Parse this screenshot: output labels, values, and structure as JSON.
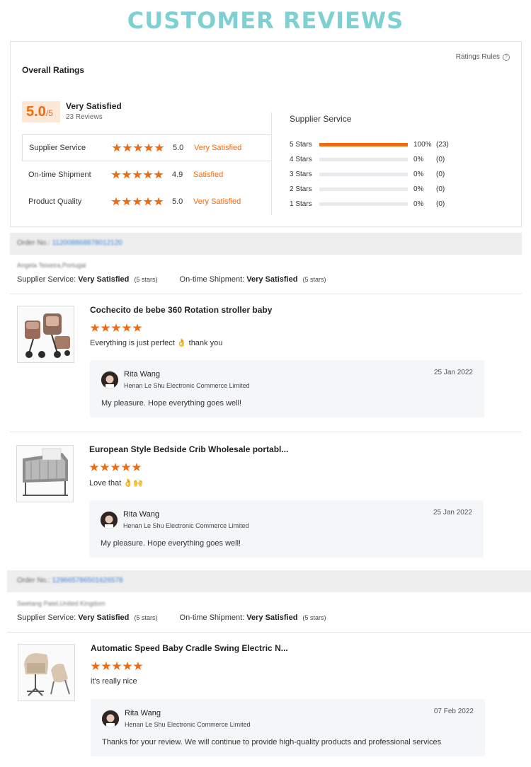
{
  "header": {
    "title": "CUSTOMER REVIEWS"
  },
  "overall": {
    "title": "Overall Ratings",
    "rules_label": "Ratings Rules",
    "score": "5.0",
    "score_max": "/5",
    "satisfaction": "Very Satisfied",
    "review_count": "23 Reviews",
    "categories": [
      {
        "label": "Supplier Service",
        "value": "5.0",
        "text": "Very Satisfied",
        "stars": 5
      },
      {
        "label": "On-time Shipment",
        "value": "4.9",
        "text": "Satisfied",
        "stars": 5
      },
      {
        "label": "Product Quality",
        "value": "5.0",
        "text": "Very Satisfied",
        "stars": 5
      }
    ]
  },
  "breakdown": {
    "title": "Supplier Service",
    "rows": [
      {
        "label": "5 Stars",
        "fraction": 1.0,
        "percent": "100%",
        "count": "(23)"
      },
      {
        "label": "4 Stars",
        "fraction": 0,
        "percent": "0%",
        "count": "(0)"
      },
      {
        "label": "3 Stars",
        "fraction": 0,
        "percent": "0%",
        "count": "(0)"
      },
      {
        "label": "2 Stars",
        "fraction": 0,
        "percent": "0%",
        "count": "(0)"
      },
      {
        "label": "1 Stars",
        "fraction": 0,
        "percent": "0%",
        "count": "(0)"
      }
    ]
  },
  "orders": [
    {
      "order_label": "Order No.:",
      "order_no": "112008868878012120",
      "buyer": "Angela Teixeira,Portugal",
      "supplier_service_label": "Supplier Service:",
      "supplier_service_value": "Very Satisfied",
      "supplier_service_stars": "(5 stars)",
      "shipment_label": "On-time Shipment:",
      "shipment_value": "Very Satisfied",
      "shipment_stars": "(5 stars)",
      "reviews": [
        {
          "product": "Cochecito de bebe 360 Rotation stroller baby",
          "stars": 5,
          "text": "Everything is just perfect 👌 thank you",
          "reply": {
            "name": "Rita Wang",
            "company": "Henan Le Shu Electronic Commerce Limited",
            "date": "25 Jan 2022",
            "message": "My pleasure. Hope everything goes well!"
          }
        },
        {
          "product": "European Style Bedside Crib Wholesale portabl...",
          "stars": 5,
          "text": "Love that 👌🙌",
          "reply": {
            "name": "Rita Wang",
            "company": "Henan Le Shu Electronic Commerce Limited",
            "date": "25 Jan 2022",
            "message": "My pleasure. Hope everything goes well!"
          }
        }
      ]
    },
    {
      "order_label": "Order No.:",
      "order_no": "129665786501626578",
      "buyer": "Swetang Patel,United Kingdom",
      "supplier_service_label": "Supplier Service:",
      "supplier_service_value": "Very Satisfied",
      "supplier_service_stars": "(5 stars)",
      "shipment_label": "On-time Shipment:",
      "shipment_value": "Very Satisfied",
      "shipment_stars": "(5 stars)",
      "reviews": [
        {
          "product": "Automatic Speed Baby Cradle Swing Electric N...",
          "stars": 5,
          "text": "it's really nice",
          "reply": {
            "name": "Rita Wang",
            "company": "Henan Le Shu Electronic Commerce Limited",
            "date": "07 Feb 2022",
            "message": "Thanks for your review. We will continue to provide high-quality products and professional services"
          }
        }
      ]
    }
  ],
  "colors": {
    "accent": "#f26a0f",
    "header": "#7fd0d2",
    "link": "#3d7fd8"
  }
}
